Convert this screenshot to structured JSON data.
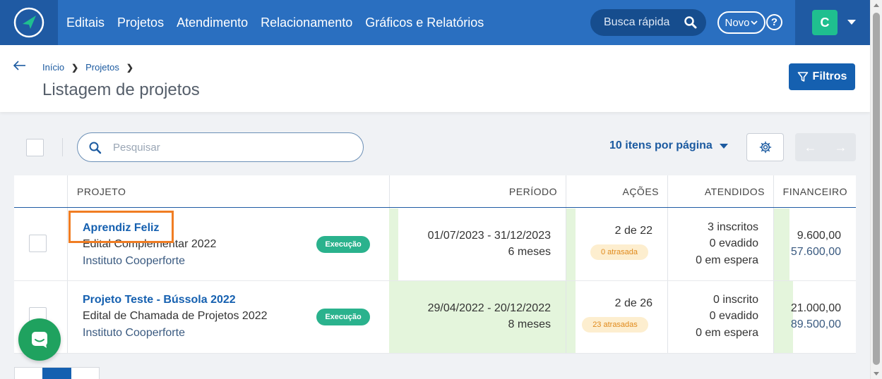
{
  "nav": {
    "items": [
      "Editais",
      "Projetos",
      "Atendimento",
      "Relacionamento",
      "Gráficos e Relatórios"
    ],
    "quick_search": "Busca rápida",
    "novo_label": "Novo",
    "help_label": "?",
    "user_initial": "C"
  },
  "breadcrumb": [
    "Início",
    "Projetos"
  ],
  "page_title": "Listagem de projetos",
  "filters_label": "Filtros",
  "toolbar": {
    "search_placeholder": "Pesquisar",
    "per_page": "10 itens por página"
  },
  "table": {
    "headers": {
      "projeto": "PROJETO",
      "periodo": "PERÍODO",
      "acoes": "AÇÕES",
      "atendidos": "ATENDIDOS",
      "financeiro": "FINANCEIRO"
    },
    "rows": [
      {
        "name": "Aprendiz Feliz",
        "edital": "Edital Complementar 2022",
        "instituto": "Instituto Cooperforte",
        "status": "Execução",
        "period_range": "01/07/2023 - 31/12/2023",
        "period_length": "6 meses",
        "acoes": "2 de 22",
        "atrasadas": "0 atrasada",
        "inscritos": "3 inscritos",
        "evadido": "0 evadido",
        "espera": "0 em espera",
        "fin_1": "9.600,00",
        "fin_2": "57.600,00"
      },
      {
        "name": "Projeto Teste - Bússola 2022",
        "edital": "Edital de Chamada de Projetos 2022",
        "instituto": "Instituto Cooperforte",
        "status": "Execução",
        "period_range": "29/04/2022 - 20/12/2022",
        "period_length": "8 meses",
        "acoes": "2 de 26",
        "atrasadas": "23 atrasadas",
        "inscritos": "0 inscrito",
        "evadido": "0 evadido",
        "espera": "0 em espera",
        "fin_1": "21.000,00",
        "fin_2": "89.500,00"
      }
    ]
  },
  "colors": {
    "nav_bg": "#2a6fc0",
    "primary": "#1560b0",
    "status_green": "#2ab28d",
    "highlight": "#f07d23",
    "period_green": "#e4f5dc"
  }
}
